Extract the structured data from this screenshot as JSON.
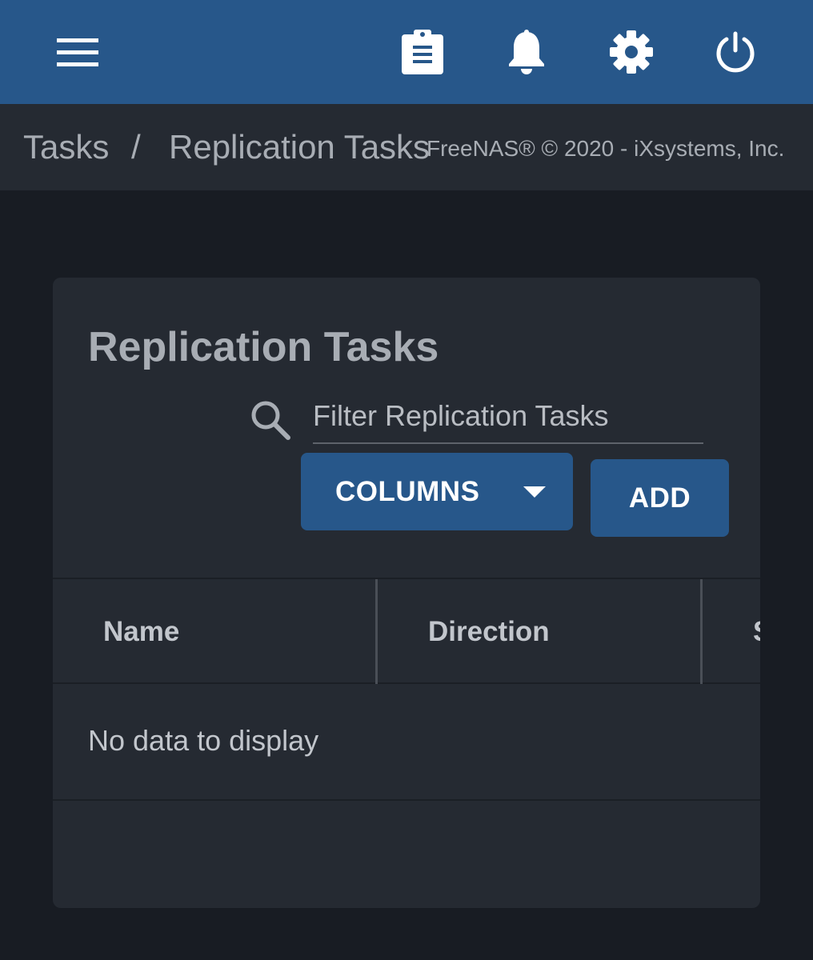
{
  "topbar": {
    "icons": [
      "menu-icon",
      "clipboard-icon",
      "bell-icon",
      "gear-icon",
      "power-icon"
    ],
    "accent_color": "#27578a"
  },
  "breadcrumb": {
    "items": [
      "Tasks",
      "Replication Tasks"
    ],
    "separator": "/"
  },
  "footer": {
    "copyright": "FreeNAS® © 2020 - iXsystems, Inc."
  },
  "card": {
    "title": "Replication Tasks",
    "filter": {
      "placeholder": "Filter Replication Tasks",
      "value": ""
    },
    "buttons": {
      "columns_label": "COLUMNS",
      "add_label": "ADD"
    }
  },
  "table": {
    "columns": [
      "Name",
      "Direction",
      "S"
    ],
    "empty_message": "No data to display"
  }
}
